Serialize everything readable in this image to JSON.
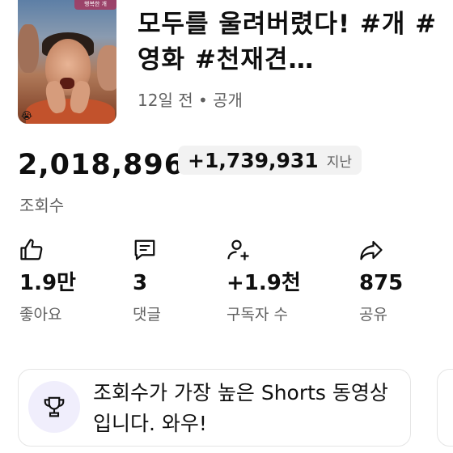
{
  "video": {
    "title": "모두를 울려버렸다! #개 #영화 #천재견…",
    "meta": "12일 전 • 공개",
    "thumbnail_caption": "행복한 개",
    "thumbnail_emoji": "😭"
  },
  "views": {
    "count": "2,018,896",
    "delta_value": "+1,739,931",
    "delta_suffix": "지난",
    "label": "조회수"
  },
  "stats": [
    {
      "icon": "thumbs-up-icon",
      "value": "1.9만",
      "label": "좋아요"
    },
    {
      "icon": "comment-icon",
      "value": "3",
      "label": "댓글"
    },
    {
      "icon": "add-person-icon",
      "value": "+1.9천",
      "label": "구독자 수"
    },
    {
      "icon": "share-icon",
      "value": "875",
      "label": "공유"
    }
  ],
  "banner": {
    "icon": "trophy-icon",
    "message": "조회수가 가장 높은 Shorts 동영상입니다. 와우!"
  },
  "colors": {
    "text_primary": "#0f0f0f",
    "text_secondary": "#606060",
    "chip_bg": "#f2f2f2",
    "trophy_bg": "#f0eefc"
  }
}
